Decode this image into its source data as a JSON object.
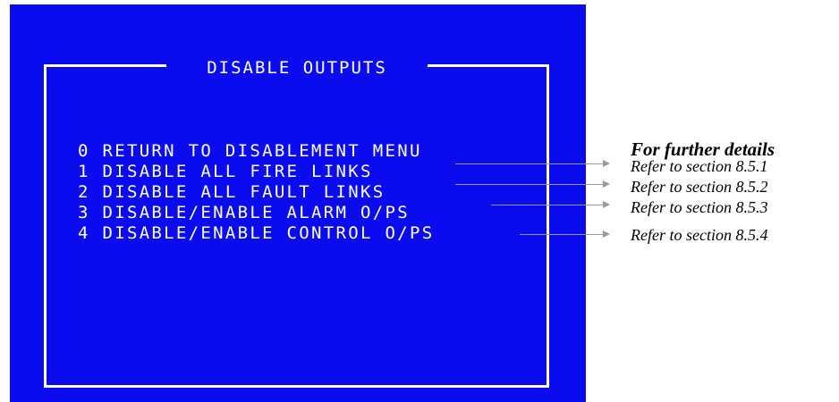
{
  "screen": {
    "title": "DISABLE OUTPUTS",
    "menu_items": [
      "0 RETURN TO DISABLEMENT MENU",
      "1 DISABLE ALL FIRE LINKS",
      "2 DISABLE ALL FAULT LINKS",
      "3 DISABLE/ENABLE ALARM O/PS",
      "4 DISABLE/ENABLE CONTROL O/PS"
    ]
  },
  "annotations": {
    "heading": "For further details",
    "references": [
      "Refer to section 8.5.1",
      "Refer to section 8.5.2",
      "Refer to section 8.5.3",
      "Refer to section 8.5.4"
    ]
  },
  "colors": {
    "screen_background": "#0b0bf0",
    "screen_text": "#ffffff",
    "arrow": "#9a9a9a"
  }
}
